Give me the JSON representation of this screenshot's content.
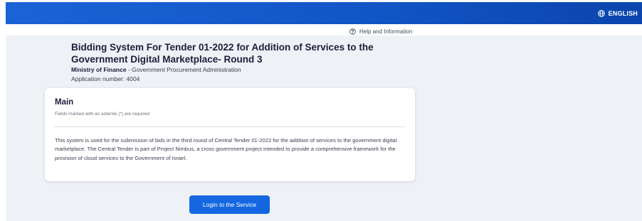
{
  "header": {
    "language_label": "ENGLISH",
    "language_icon": "globe-icon",
    "background_colors": [
      "#1a63d6",
      "#0b45ad"
    ]
  },
  "help": {
    "label": "Help and Information",
    "icon": "question-circle-icon"
  },
  "tender": {
    "title": "Bidding System For Tender 01-2022 for Addition of Services to the Government Digital Marketplace- Round 3",
    "ministry": "Ministry of Finance",
    "administration": " - Government Procurement Administration",
    "application_number": "Application number: 4004"
  },
  "card": {
    "title": "Main",
    "required_note": "Fields marked with an asterisk (*) are required",
    "body": "This system is used for the submission of bids in the third round of Central Tender 01-2022 for the addition of services to the government digital marketplace. The Central Tender is part of Project Nimbus, a cross government project intended to provide a comprehensive framework for the provision of cloud services to the Government of Israel."
  },
  "actions": {
    "login_label": "Login to the Service",
    "accent_color": "#1467e0"
  }
}
